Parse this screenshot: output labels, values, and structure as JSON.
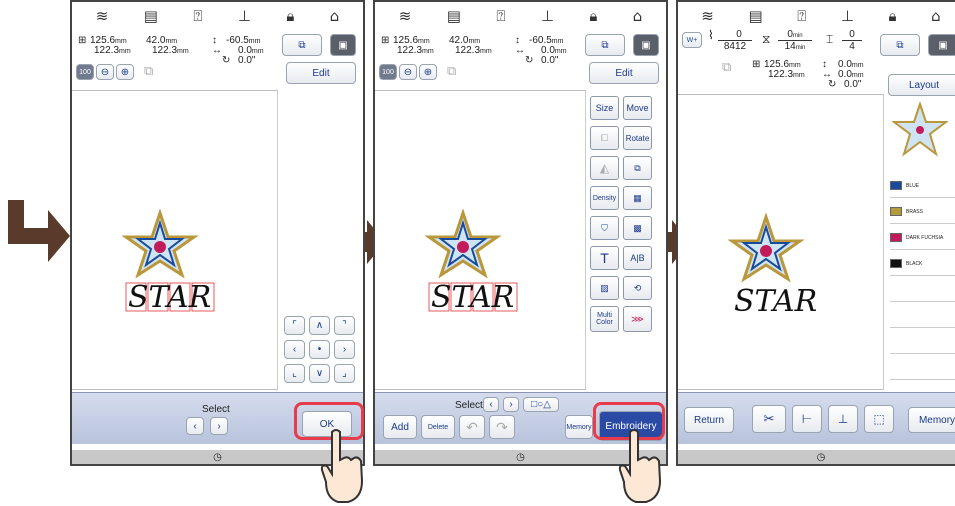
{
  "status_icons": [
    "wifi-icon",
    "file-icon",
    "help-icon",
    "machine-icon",
    "lock-icon",
    "home-icon"
  ],
  "dims": {
    "w": "125.6",
    "h": "122.3",
    "sw": "42.0",
    "sh": "122.3",
    "dy": "-60.5",
    "dx": "0.0",
    "ang": "0.0\"",
    "unit": "mm"
  },
  "zoom_label": "100",
  "text_design": "STAR",
  "screen1": {
    "edit": "Edit",
    "select": "Select",
    "ok": "OK"
  },
  "screen2": {
    "edit": "Edit",
    "size": "Size",
    "move": "Move",
    "rotate": "Rotate",
    "density": "Density",
    "multi_color": "Multi Color",
    "select": "Select",
    "add": "Add",
    "delete": "Delete",
    "memory": "Memory",
    "embroidery": "Embroidery"
  },
  "screen3": {
    "stitch_count": "8412",
    "time_total": "14",
    "time_done": "0",
    "time_unit": "min",
    "color_total": "4",
    "color_done": "0",
    "layout": "Layout",
    "return": "Return",
    "memory": "Memory",
    "thread_colors": [
      "BLUE",
      "BRASS",
      "DARK FUCHSIA",
      "BLACK"
    ],
    "swatches": [
      "#1a4a9a",
      "#b39a3c",
      "#c21a5a",
      "#111111"
    ]
  }
}
